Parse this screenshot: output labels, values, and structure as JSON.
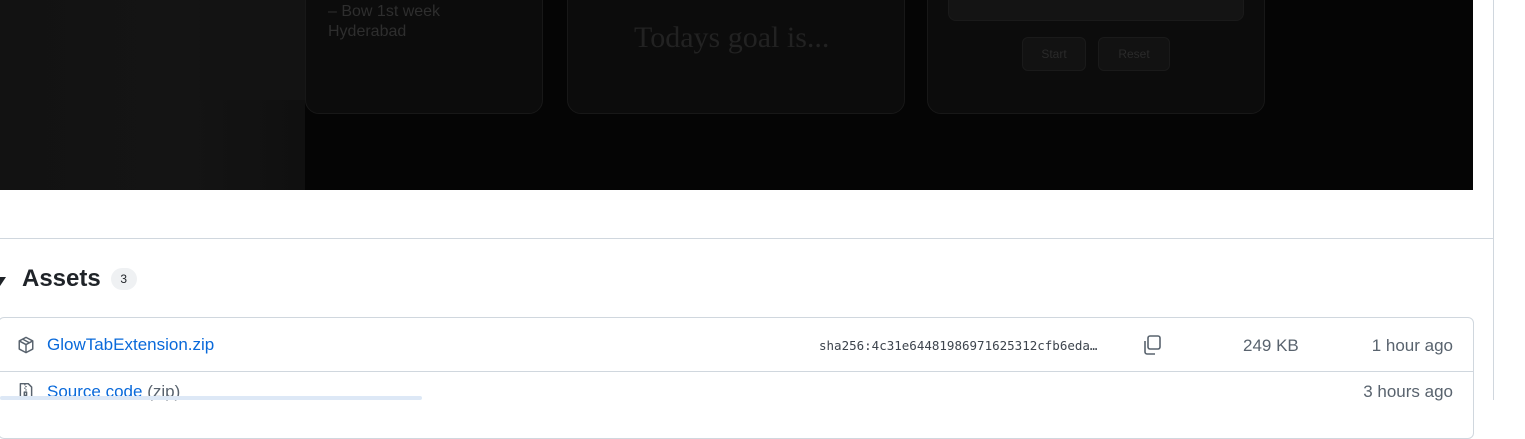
{
  "preview": {
    "card1_lines": [
      "– Bow 1st week",
      "Hyderabad"
    ],
    "card2_text": "Todays goal is...",
    "card3_buttons": [
      "Start",
      "Reset"
    ]
  },
  "assets": {
    "title": "Assets",
    "count": "3",
    "rows": [
      {
        "icon": "package-icon",
        "name": "GlowTabExtension.zip",
        "hash": "sha256:4c31e64481986971625312cfb6eda…",
        "size": "249 KB",
        "time": "1 hour ago"
      },
      {
        "icon": "file-zip-icon",
        "name": "Source code",
        "suffix": "(zip)",
        "time": "3 hours ago"
      }
    ]
  }
}
